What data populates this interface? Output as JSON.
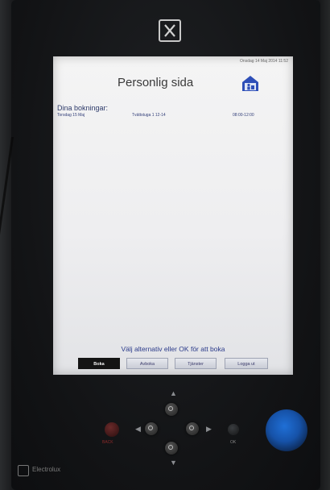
{
  "device": {
    "brand_icon": "electrolux-logo-icon",
    "footer_brand": "Electrolux"
  },
  "screen": {
    "datetime": "Onsdag 14 Maj 2014 11:52",
    "title": "Personlig sida",
    "home_icon": "home-person-icon",
    "bookings_label": "Dina bokningar:",
    "bookings": [
      {
        "day": "Torsdag 15 Maj",
        "room": "Tvättstuga 1 12-14",
        "time": "08:00-12:00"
      }
    ],
    "instruction": "Välj alternativ eller OK för att boka",
    "softkeys": [
      {
        "label": "Boka",
        "active": true
      },
      {
        "label": "Avboka",
        "active": false
      },
      {
        "label": "Tjänster",
        "active": false
      },
      {
        "label": "Logga ut",
        "active": false
      }
    ]
  },
  "controls": {
    "back_label": "BACK",
    "ok_label": "OK",
    "colors": {
      "back_key": "#6a2a2a",
      "reader_blue": "#1f6fd6",
      "active_softkey": "#141414"
    }
  }
}
